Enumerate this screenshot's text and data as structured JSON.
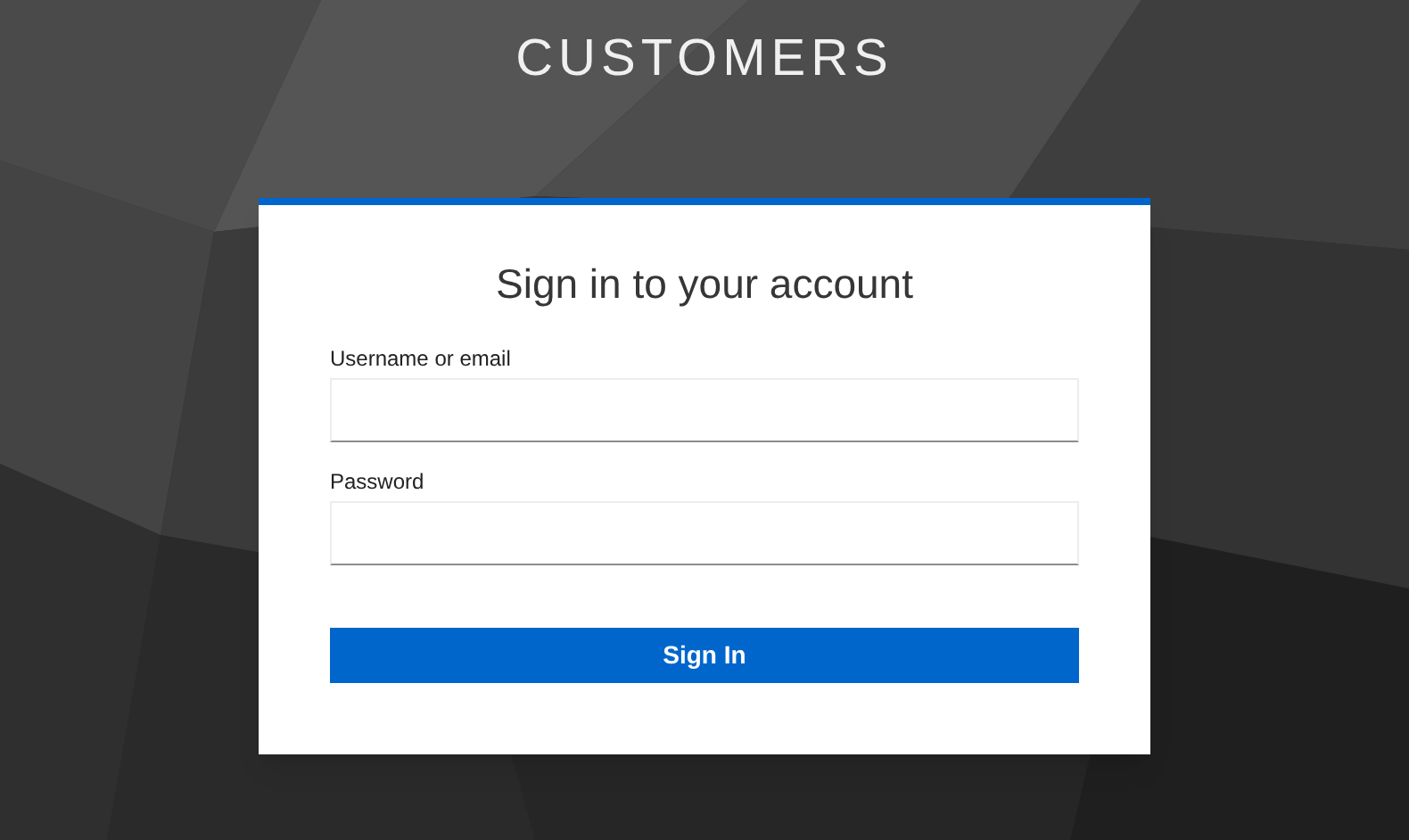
{
  "realm_title": "CUSTOMERS",
  "login_card": {
    "heading": "Sign in to your account",
    "fields": [
      {
        "label": "Username or email"
      },
      {
        "label": "Password"
      }
    ],
    "submit_button": "Sign In"
  }
}
